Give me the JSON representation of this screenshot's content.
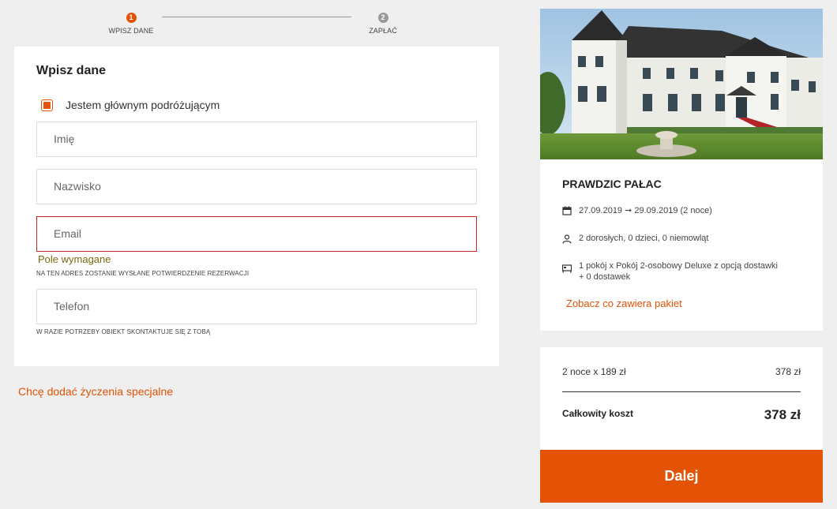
{
  "stepper": {
    "steps": [
      {
        "number": "1",
        "label": "WPISZ DANE",
        "state": "active"
      },
      {
        "number": "2",
        "label": "ZAPŁAĆ",
        "state": "inactive"
      }
    ]
  },
  "form": {
    "title": "Wpisz dane",
    "main_traveler_label": "Jestem głównym podróżującym",
    "main_traveler_checked": true,
    "fields": {
      "first_name": {
        "placeholder": "Imię",
        "value": ""
      },
      "last_name": {
        "placeholder": "Nazwisko",
        "value": ""
      },
      "email": {
        "placeholder": "Email",
        "value": "",
        "error": "Pole wymagane",
        "hint": "NA TEN ADRES ZOSTANIE WYSŁANE POTWIERDZENIE REZERWACJI"
      },
      "phone": {
        "placeholder": "Telefon",
        "value": "",
        "hint": "W RAZIE POTRZEBY OBIEKT SKONTAKTUJE SIĘ Z TOBĄ"
      }
    }
  },
  "special_requests_link": "Chcę dodać życzenia specjalne",
  "hotel": {
    "name": "PRAWDZIC PAŁAC",
    "dates": "27.09.2019 ➞ 29.09.2019 (2 noce)",
    "guests": "2 dorosłych, 0 dzieci, 0 niemowląt",
    "room_line1": "1 pokój x Pokój 2-osobowy Deluxe z opcją dostawki",
    "room_line2": "+ 0 dostawek",
    "package_link": "Zobacz co zawiera pakiet"
  },
  "price": {
    "line_label": "2 noce x 189 zł",
    "line_value": "378 zł",
    "total_label": "Całkowity koszt",
    "total_value": "378 zł"
  },
  "next_button": "Dalej",
  "colors": {
    "accent": "#e35205",
    "error": "#c62828",
    "background": "#efefef"
  },
  "icons": [
    "calendar-icon",
    "person-icon",
    "bed-icon"
  ]
}
